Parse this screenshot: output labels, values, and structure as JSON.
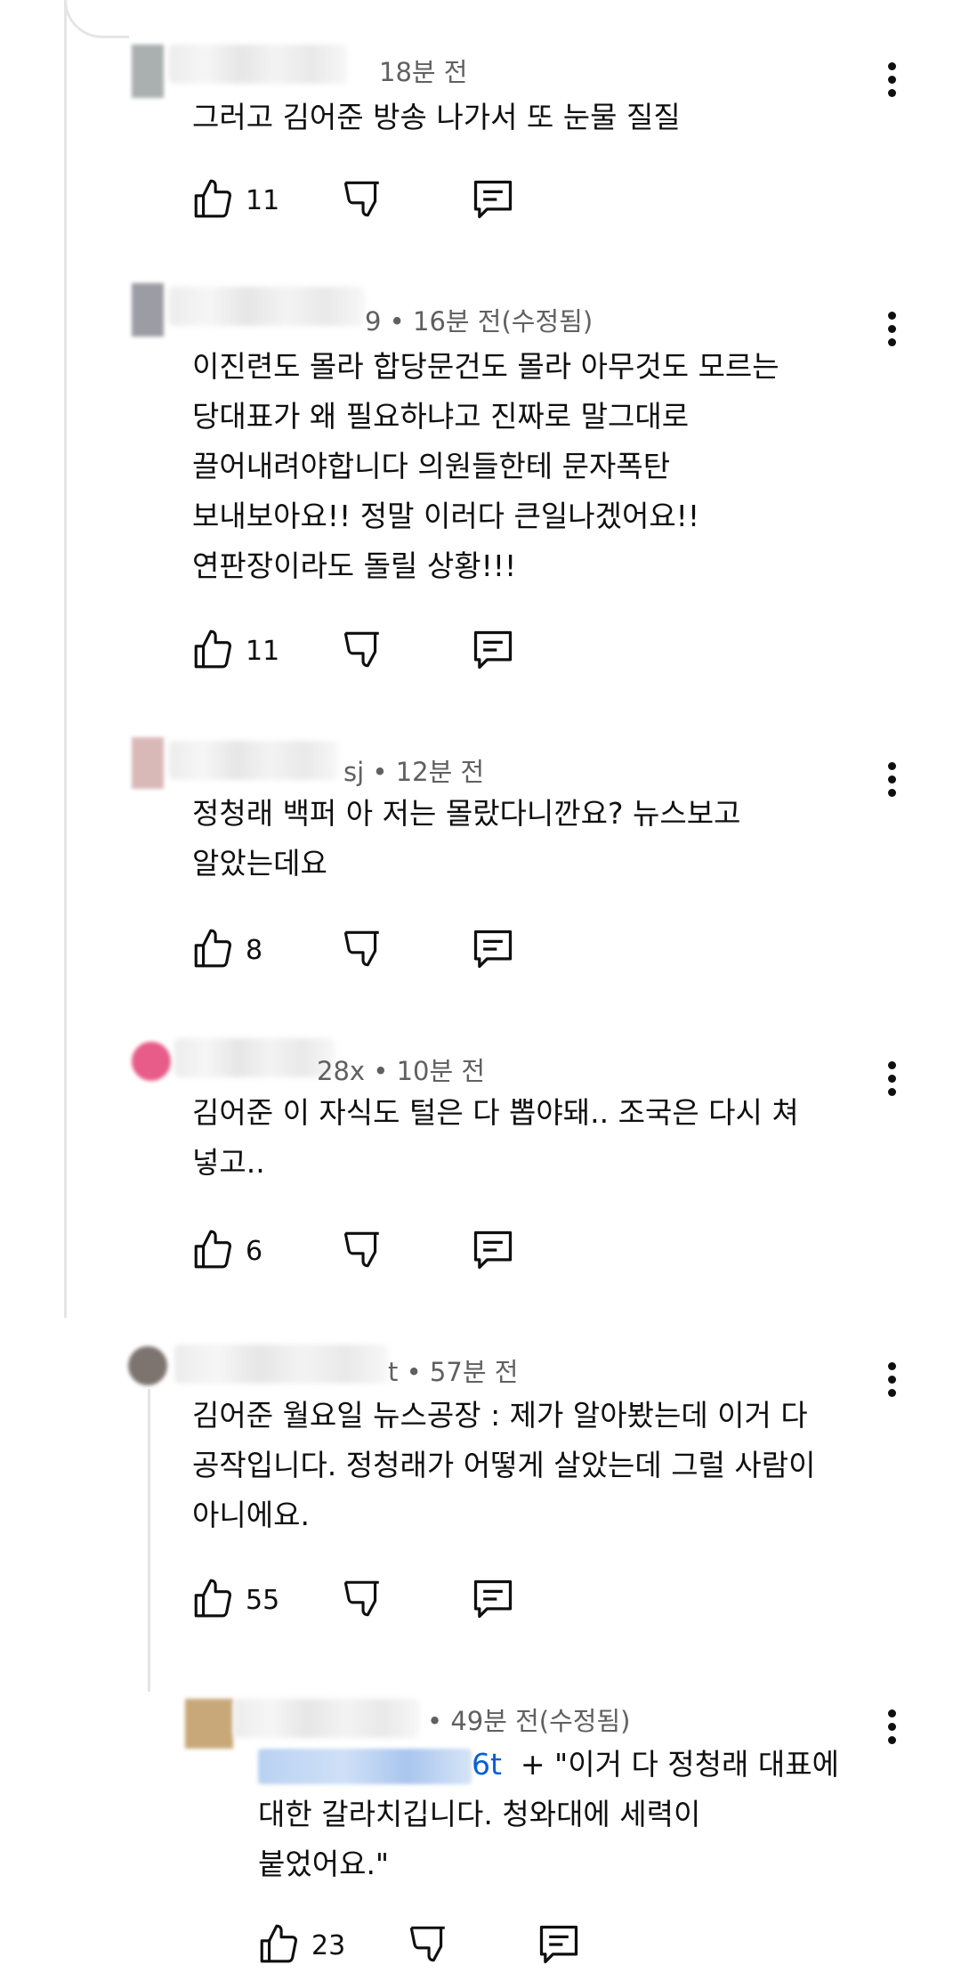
{
  "comments": [
    {
      "meta": "18분 전",
      "lines": [
        "그러고 김어준 방송 나가서 또 눈물 질질"
      ],
      "likes": "11",
      "avatar_color": "#aab0b0"
    },
    {
      "meta": "9 • 16분 전(수정됨)",
      "lines": [
        "이진련도 몰라 합당문건도 몰라 아무것도 모르는",
        "당대표가 왜 필요하냐고 진짜로 말그대로",
        "끌어내려야합니다 의원들한테 문자폭탄",
        "보내보아요!! 정말 이러다 큰일나겠어요!!",
        "연판장이라도 돌릴 상황!!!"
      ],
      "likes": "11",
      "avatar_color": "#9c9ca4"
    },
    {
      "meta": "sj • 12분 전",
      "lines": [
        "정청래 백퍼 아 저는 몰랐다니깐요? 뉴스보고",
        "알았는데요"
      ],
      "likes": "8",
      "avatar_color": "#d9b8b8"
    },
    {
      "meta": "28x • 10분 전",
      "lines": [
        "김어준 이 자식도 털은 다 뽑야돼.. 조국은 다시 쳐",
        "넣고.."
      ],
      "likes": "6",
      "avatar_color": "#e85c8a"
    },
    {
      "meta": "t • 57분 전",
      "lines": [
        "김어준 월요일 뉴스공장 : 제가 알아봤는데 이거 다",
        "공작입니다. 정청래가 어떻게 살았는데 그럴 사람이",
        "아니에요."
      ],
      "likes": "55",
      "avatar_color": "#7d7470"
    },
    {
      "meta": "• 49분 전(수정됨)",
      "mention": "6t",
      "first_line_rest": "+ \"이거 다 정청래 대표에",
      "lines": [
        "대한 갈라치깁니다. 청와대에 세력이",
        "붙었어요.\""
      ],
      "likes": "23",
      "avatar_color": "#c8a878"
    }
  ]
}
